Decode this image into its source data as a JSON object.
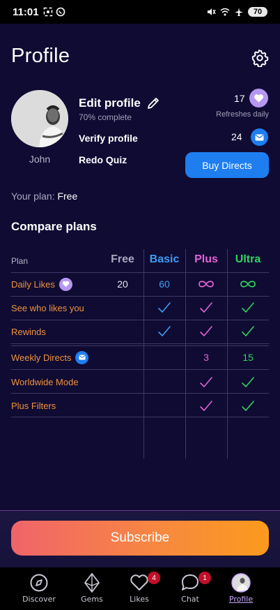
{
  "status_bar": {
    "time": "11:01",
    "battery": "70"
  },
  "header": {
    "title": "Profile"
  },
  "profile": {
    "name": "John",
    "edit_label": "Edit profile",
    "complete_text": "70% complete",
    "verify_label": "Verify profile",
    "quiz_label": "Redo Quiz"
  },
  "stats": {
    "likes_count": "17",
    "refresh_text": "Refreshes daily",
    "directs_count": "24",
    "buy_directs_label": "Buy Directs"
  },
  "plan": {
    "label": "Your plan:",
    "value": "Free"
  },
  "compare": {
    "title": "Compare plans",
    "headers": [
      "Plan",
      "Free",
      "Basic",
      "Plus",
      "Ultra"
    ],
    "header_colors": [
      "#b5b3c9",
      "#a9a7bf",
      "#3f9cf5",
      "#e264d4",
      "#2ed45a"
    ],
    "rows": [
      {
        "feature": "Daily Likes",
        "badge": "heart-icon",
        "free": "20",
        "basic": "60",
        "plus": "∞",
        "ultra": "∞"
      },
      {
        "feature": "See who likes you",
        "free": "",
        "basic": "check",
        "plus": "check",
        "ultra": "check"
      },
      {
        "feature": "Rewinds",
        "free": "",
        "basic": "check",
        "plus": "check",
        "ultra": "check"
      },
      {
        "feature": "Weekly Directs",
        "badge": "mail-icon",
        "free": "",
        "basic": "",
        "plus": "3",
        "ultra": "15"
      },
      {
        "feature": "Worldwide Mode",
        "free": "",
        "basic": "",
        "plus": "check",
        "ultra": "check"
      },
      {
        "feature": "Plus Filters",
        "free": "",
        "basic": "",
        "plus": "check",
        "ultra": "check"
      }
    ]
  },
  "subscribe_label": "Subscribe",
  "tabs": [
    {
      "label": "Discover",
      "icon": "compass-icon"
    },
    {
      "label": "Gems",
      "icon": "gem-icon"
    },
    {
      "label": "Likes",
      "icon": "heart-icon",
      "badge": "4"
    },
    {
      "label": "Chat",
      "icon": "chat-icon",
      "badge": "1"
    },
    {
      "label": "Profile",
      "icon": "avatar-icon",
      "active": true
    }
  ],
  "colors": {
    "background": "#0f0b33",
    "accent_blue": "#1e7ef0",
    "feature_orange": "#f0923a",
    "likes_purple": "#b597f0"
  }
}
